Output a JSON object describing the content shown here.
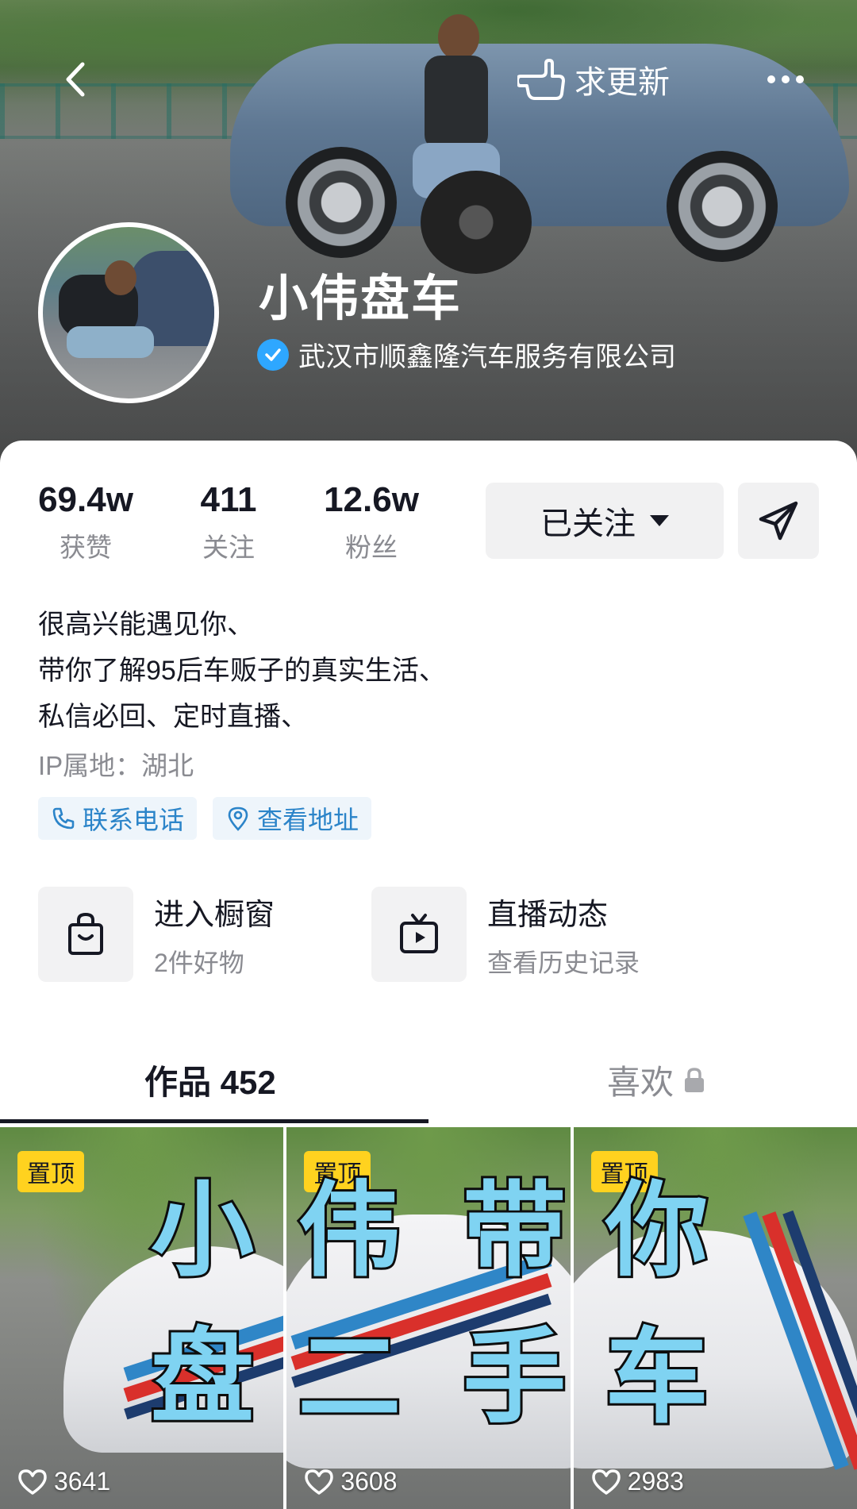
{
  "header": {
    "request_update_label": "求更新"
  },
  "profile": {
    "nickname": "小伟盘车",
    "verified_org": "武汉市顺鑫隆汽车服务有限公司"
  },
  "stats": [
    {
      "value": "69.4w",
      "label": "获赞"
    },
    {
      "value": "411",
      "label": "关注"
    },
    {
      "value": "12.6w",
      "label": "粉丝"
    }
  ],
  "actions": {
    "follow_label": "已关注"
  },
  "bio": {
    "lines": [
      "很高兴能遇见你、",
      "带你了解95后车贩子的真实生活、",
      "私信必回、定时直播、"
    ],
    "ip": "IP属地：湖北"
  },
  "chips": {
    "phone": "联系电话",
    "address": "查看地址"
  },
  "services": [
    {
      "title": "进入橱窗",
      "subtitle": "2件好物",
      "icon": "shopping-bag-icon"
    },
    {
      "title": "直播动态",
      "subtitle": "查看历史记录",
      "icon": "tv-icon"
    }
  ],
  "tabs": {
    "works": "作品 452",
    "likes": "喜欢"
  },
  "videos": [
    {
      "pin": "置顶",
      "chars": [
        "小",
        "盘"
      ],
      "likes": "3641"
    },
    {
      "pin": "置顶",
      "chars": [
        "伟",
        "带",
        "二",
        "手"
      ],
      "likes": "3608"
    },
    {
      "pin": "置顶",
      "chars": [
        "你",
        "车"
      ],
      "likes": "2983"
    }
  ],
  "colors": {
    "verify_blue": "#2ea7ff",
    "chip_text": "#2b84c9",
    "pin_yellow": "#ffd21f",
    "overlay_text": "#7fd3f2"
  }
}
